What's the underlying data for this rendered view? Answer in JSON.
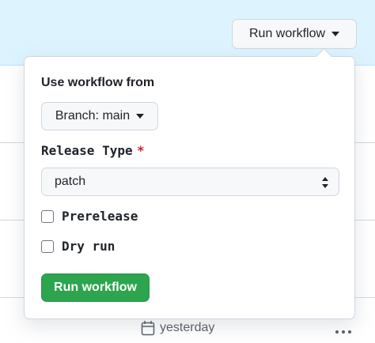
{
  "header": {
    "run_workflow_label": "Run workflow"
  },
  "popover": {
    "use_workflow_from_label": "Use workflow from",
    "branch_label": "Branch: main",
    "release_type_label": "Release Type",
    "required_marker": "*",
    "release_type_value": "patch",
    "prerelease_label": "Prerelease",
    "prerelease_checked": false,
    "dry_run_label": "Dry run",
    "dry_run_checked": false,
    "submit_label": "Run workflow"
  },
  "background_row": {
    "timestamp": "yesterday"
  },
  "colors": {
    "accent_band": "#ddf4ff",
    "primary_button": "#2da44e",
    "required": "#cf222e"
  },
  "icons": [
    "caret-down-icon",
    "select-updown-icon",
    "calendar-icon",
    "kebab-menu-icon"
  ]
}
